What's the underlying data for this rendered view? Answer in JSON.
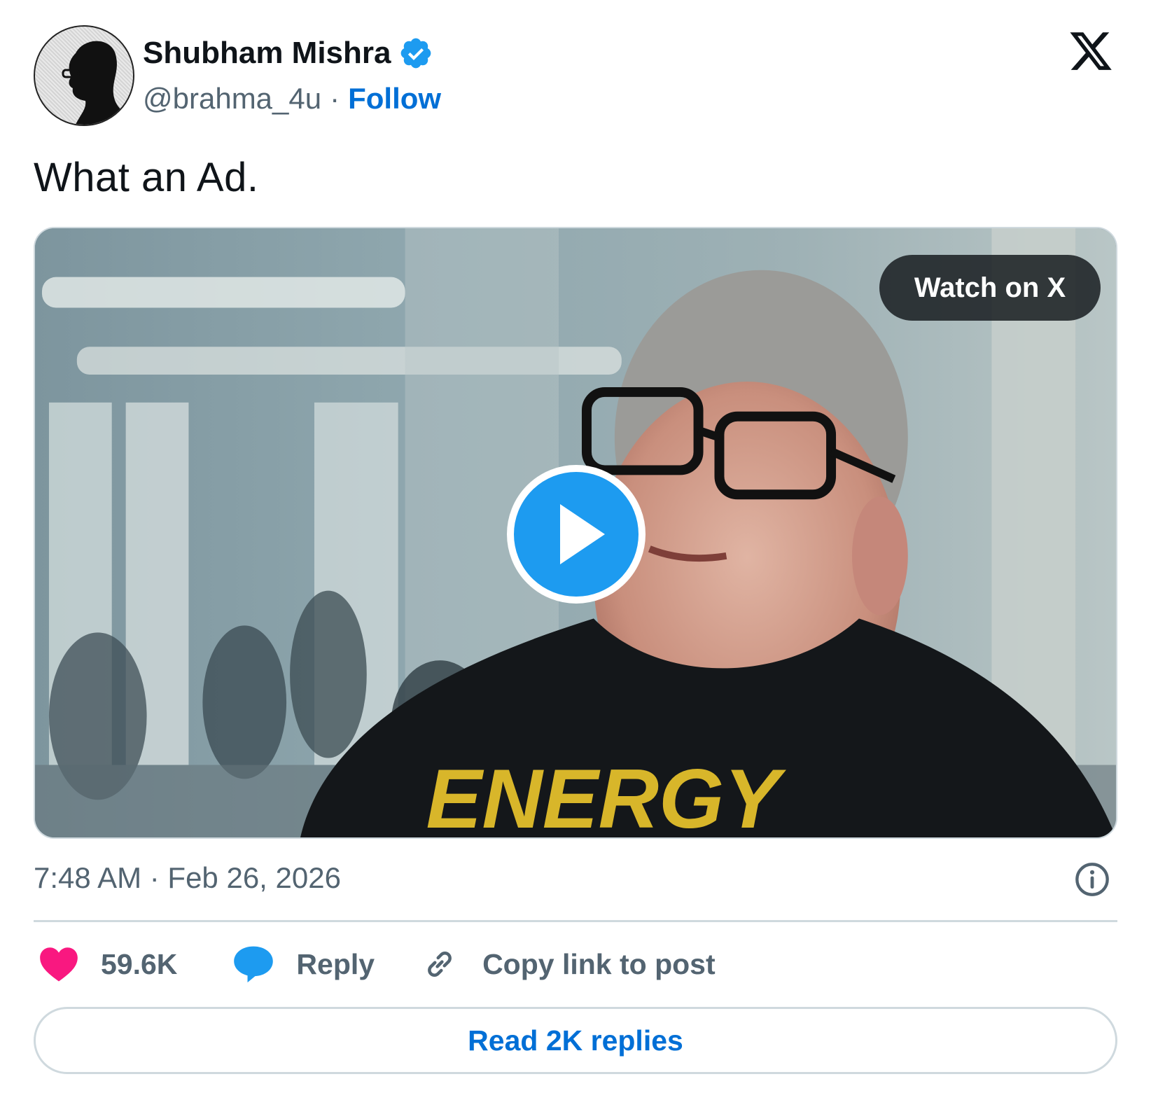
{
  "author": {
    "name": "Shubham Mishra",
    "handle": "@brahma_4u",
    "separator": "·",
    "follow_label": "Follow",
    "verified": true
  },
  "icons": {
    "verified": "verified-badge-icon",
    "logo": "x-logo-icon",
    "play": "play-icon",
    "info": "info-icon",
    "like": "heart-icon",
    "reply": "speech-bubble-icon",
    "copy": "link-icon"
  },
  "tweet": {
    "text": "What an Ad."
  },
  "media": {
    "watch_label": "Watch on X",
    "shirt_text": "ENERGY"
  },
  "meta": {
    "timestamp": "7:48 AM · Feb 26, 2026"
  },
  "actions": {
    "likes": "59.6K",
    "reply_label": "Reply",
    "copy_label": "Copy link to post"
  },
  "replies_button": {
    "label": "Read 2K replies"
  },
  "colors": {
    "accent": "#1d9bf0",
    "link": "#006fd6",
    "like": "#f91880",
    "muted": "#536471",
    "text": "#0f1419"
  }
}
